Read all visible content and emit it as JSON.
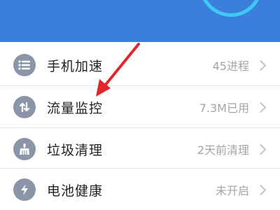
{
  "header": {
    "background_color": "#3a7fd9",
    "dial_color": "#41c7f5"
  },
  "rows": [
    {
      "icon": "list-icon",
      "label": "手机加速",
      "value": "45进程"
    },
    {
      "icon": "traffic-arrows-icon",
      "label": "流量监控",
      "value": "7.3M已用"
    },
    {
      "icon": "broom-icon",
      "label": "垃圾清理",
      "value": "2天前清理"
    },
    {
      "icon": "lightning-icon",
      "label": "电池健康",
      "value": "未开启"
    }
  ],
  "annotation": {
    "type": "red-arrow",
    "color": "#e0252b",
    "points_to": "流量监控"
  }
}
